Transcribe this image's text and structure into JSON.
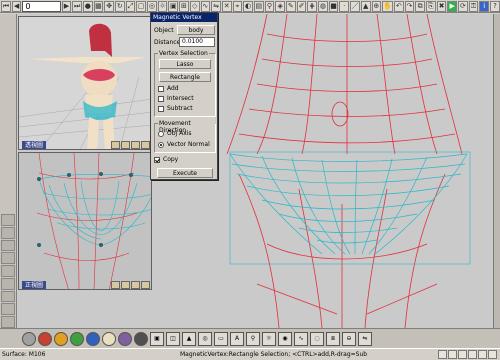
{
  "toolbar": {
    "frame_value": "0"
  },
  "viewports": {
    "persp_label": "透視圖",
    "front_label": "正視圖",
    "front_marker": "1"
  },
  "dialog": {
    "title": "Magnetic Vertex",
    "object_label": "Object",
    "object_value": "body",
    "distance_label": "Distance",
    "distance_value": "0.0100",
    "vertex_selection_title": "Vertex Selection",
    "lasso_label": "Lasso",
    "rectangle_label": "Rectangle",
    "add_label": "Add",
    "intersect_label": "Intersect",
    "subtract_label": "Subtract",
    "movement_title": "Movement Direction",
    "obj_axis_label": "Obj Axis",
    "vector_normal_label": "Vector Normal",
    "copy_label": "Copy",
    "execute_label": "Execute",
    "add_checked": false,
    "intersect_checked": false,
    "subtract_checked": false,
    "copy_checked": true,
    "movement": "vector_normal"
  },
  "status": {
    "left": "Surface: M106",
    "middle": "MagneticVertex:Rectangle Selection; <CTRL>add,R-drag=Sub"
  },
  "colors": {
    "mesh_red": "#e0303c",
    "selection_cyan": "#2ab8c8",
    "title_blue": "#0a246a"
  }
}
